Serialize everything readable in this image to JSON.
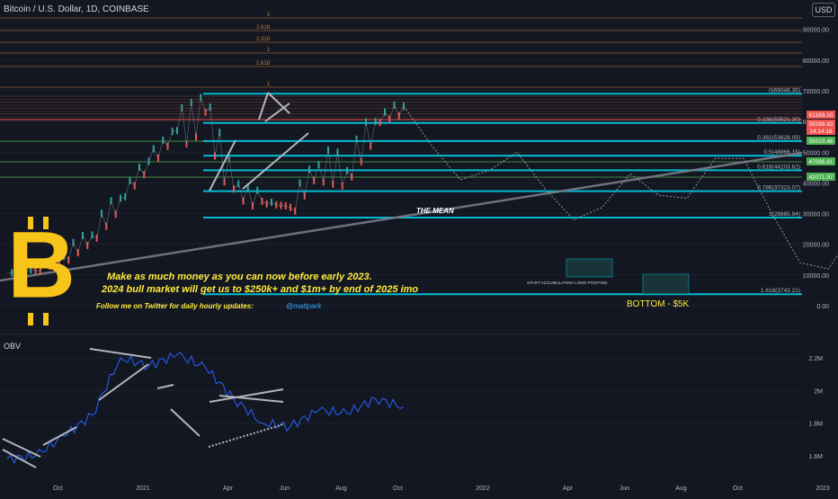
{
  "header": {
    "title": "Bitcoin / U.S. Dollar, 1D, COINBASE",
    "currency_button": "USD"
  },
  "colors": {
    "background": "#131722",
    "candle_up": "#26a69a",
    "candle_down": "#ef5350",
    "fib_line": "#00bcd4",
    "annotation_yellow": "#ffeb3b",
    "projection": "#9598a1",
    "obv_line": "#2962ff",
    "bitcoin_logo": "#f7c41a"
  },
  "annotations": {
    "line1": "Make as much money as you can now before early 2023.",
    "line2": "2024 bull market will get us to $250k+ and $1m+ by end of 2025 imo",
    "twitter_prompt": "Follow me on Twitter for daily hourly updates:",
    "twitter_handle": "@mattpark",
    "the_mean": "THE MEAN",
    "bottom": "BOTTOM - $5K",
    "accumulate": "START ACCUMULATING LONG POSITION"
  },
  "obv_pane": {
    "title": "OBV"
  },
  "price_tags": [
    {
      "text": "61189.10",
      "color": "#ef5350"
    },
    {
      "text": "59289.83",
      "color": "#ef5350"
    },
    {
      "text": "14:14:16",
      "color": "#ef5350"
    },
    {
      "text": "55023.46",
      "color": "#4caf50"
    },
    {
      "text": "47086.81",
      "color": "#4caf50"
    },
    {
      "text": "42071.97",
      "color": "#4caf50"
    }
  ],
  "chart_data": [
    {
      "type": "line",
      "title": "Bitcoin / U.S. Dollar, 1D, COINBASE",
      "y_axis_ticks": [
        "90000.00",
        "80000.00",
        "70000.00",
        "60000.00",
        "50000.00",
        "40000.00",
        "30000.00",
        "20000.00",
        "10000.00",
        "0.00"
      ],
      "x_axis_ticks": [
        "Oct",
        "2021",
        "Apr",
        "Jun",
        "Aug",
        "Oct",
        "2022",
        "Apr",
        "Jun",
        "Aug",
        "Oct",
        "2023",
        "Apr"
      ],
      "ylim": [
        -3000,
        102000
      ],
      "fib_levels": [
        {
          "label": "0(69046.35)",
          "value": 69046.35
        },
        {
          "label": "0.236(59521.30)",
          "value": 59521.3
        },
        {
          "label": "0.382(53628.05)",
          "value": 53628.05
        },
        {
          "label": "0.5(48866.15)",
          "value": 48866.15
        },
        {
          "label": "0.618(44103.62)",
          "value": 44103.62
        },
        {
          "label": "0.786(37323.07)",
          "value": 37323.07
        },
        {
          "label": "1(28685.94)",
          "value": 28685.94
        },
        {
          "label": "1.618(3743.21)",
          "value": 3743.21
        }
      ],
      "upper_fib_labels": [
        "3",
        "2.618",
        "2.318",
        "2",
        "1.618",
        "1"
      ],
      "price_series": {
        "name": "",
        "x": [
          "2020-09",
          "2020-10",
          "2020-11",
          "2020-12",
          "2021-01",
          "2021-02",
          "2021-03",
          "2021-04",
          "2021-05",
          "2021-06",
          "2021-07",
          "2021-08",
          "2021-09",
          "2021-10",
          "2021-11"
        ],
        "values": [
          10500,
          11500,
          16000,
          23000,
          35000,
          47000,
          57000,
          63000,
          38000,
          34000,
          32000,
          46000,
          44000,
          60000,
          65000
        ]
      },
      "projection_series": {
        "name": "",
        "x": [
          "2021-12",
          "2022-02",
          "2022-04",
          "2022-06",
          "2022-08",
          "2022-10",
          "2022-12",
          "2023-02",
          "2023-04",
          "2023-06",
          "2023-08",
          "2023-10"
        ],
        "values": [
          52000,
          44000,
          38000,
          32000,
          36000,
          48000,
          30000,
          12000,
          22000,
          8000,
          5000,
          38000
        ]
      }
    },
    {
      "type": "line",
      "title": "OBV",
      "y_axis_ticks": [
        "2.2M",
        "2M",
        "1.8M",
        "1.6M"
      ],
      "ylim": [
        1.53,
        2.3
      ],
      "series": [
        {
          "name": "",
          "x": [
            "2020-09",
            "2020-10",
            "2020-11",
            "2020-12",
            "2021-01",
            "2021-02",
            "2021-03",
            "2021-04",
            "2021-05",
            "2021-06",
            "2021-07",
            "2021-08",
            "2021-09",
            "2021-10",
            "2021-11"
          ],
          "values": [
            1.58,
            1.6,
            1.72,
            1.85,
            2.2,
            2.15,
            2.22,
            2.14,
            1.95,
            1.8,
            1.78,
            1.88,
            1.86,
            1.95,
            1.9
          ]
        }
      ]
    }
  ]
}
